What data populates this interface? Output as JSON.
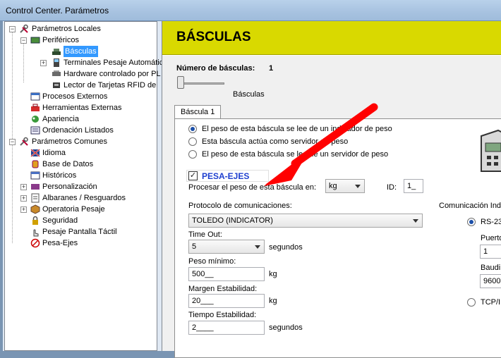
{
  "window": {
    "title": "Control Center. Parámetros"
  },
  "tree": {
    "items": [
      {
        "label": "Parámetros Locales"
      },
      {
        "label": "Periféricos"
      },
      {
        "label": "Básculas"
      },
      {
        "label": "Terminales Pesaje Automátic"
      },
      {
        "label": "Hardware controlado por PL"
      },
      {
        "label": "Lector de Tarjetas RFID de"
      },
      {
        "label": "Procesos Externos"
      },
      {
        "label": "Herramientas Externas"
      },
      {
        "label": "Apariencia"
      },
      {
        "label": "Ordenación Listados"
      },
      {
        "label": "Parámetros Comunes"
      },
      {
        "label": "Idioma"
      },
      {
        "label": "Base de Datos"
      },
      {
        "label": "Históricos"
      },
      {
        "label": "Personalización"
      },
      {
        "label": "Albaranes / Resguardos"
      },
      {
        "label": "Operatoria Pesaje"
      },
      {
        "label": "Seguridad"
      },
      {
        "label": "Pesaje Pantalla Táctil"
      },
      {
        "label": "Pesa-Ejes"
      }
    ]
  },
  "panel": {
    "title": "BÁSCULAS",
    "num_label": "Número de básculas:",
    "num_value": "1",
    "slider_caption": "Básculas",
    "tab_label": "Báscula 1",
    "radios": [
      {
        "label": "El peso de esta báscula se lee de un indicador de peso",
        "selected": true
      },
      {
        "label": "Esta báscula actúa como servidor de peso",
        "selected": false
      },
      {
        "label": "El peso de esta báscula se lee de un servidor de peso",
        "selected": false
      }
    ],
    "pesa_ejes": {
      "label": "PESA-EJES",
      "checked": true
    },
    "process_label": "Procesar el peso de esta báscula en:",
    "unit_value": "kg",
    "id_label": "ID:",
    "id_value": "1_",
    "protocol_label": "Protocolo de comunicaciones:",
    "protocol_value": "TOLEDO (INDICATOR)",
    "timeout_label": "Time Out:",
    "timeout_value": "5",
    "timeout_unit": "segundos",
    "peso_min_label": "Peso mínimo:",
    "peso_min_value": "500__",
    "peso_min_unit": "kg",
    "margen_label": "Margen Estabilidad:",
    "margen_value": "20___",
    "margen_unit": "kg",
    "tiempo_label": "Tiempo Estabilidad:",
    "tiempo_value": "2____",
    "tiempo_unit": "segundos",
    "comm": {
      "label": "Comunicación Indi",
      "rs_label": "RS-23",
      "puerto_label": "Puerto",
      "puerto_value": "1",
      "baud_label": "Baudi",
      "baud_value": "9600",
      "tcp_label": "TCP/I"
    }
  },
  "colors": {
    "header": "#d9d900",
    "arrow": "#ff0000",
    "pesa_ejes_text": "#1e3fcf"
  }
}
